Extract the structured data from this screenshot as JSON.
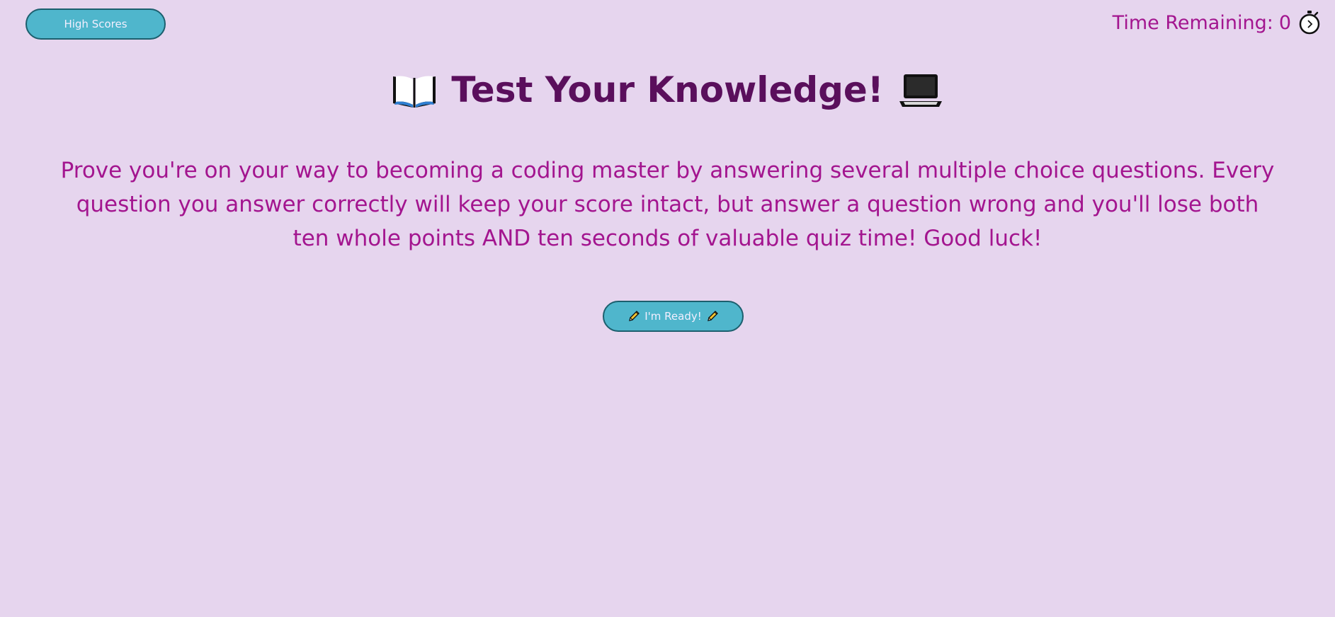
{
  "header": {
    "high_scores_label": "High Scores",
    "timer_label": "Time Remaining:",
    "timer_value": "0",
    "timer_icon": "stopwatch-icon"
  },
  "main": {
    "title": "Test Your Knowledge!",
    "title_left_icon": "open-book-icon",
    "title_right_icon": "laptop-icon",
    "intro_text": "Prove you're on your way to becoming a coding master by answering several multiple choice questions. Every question you answer correctly will keep your score intact, but answer a question wrong and you'll lose both ten whole points AND ten seconds of valuable quiz time! Good luck!",
    "start_button_label": "I'm Ready!",
    "start_button_icon": "pencil-icon"
  },
  "colors": {
    "background": "#e6d5ee",
    "button": "#4fb6cc",
    "button_border": "#1c5f6e",
    "title": "#5a0f5c",
    "text_accent": "#a3158f"
  }
}
